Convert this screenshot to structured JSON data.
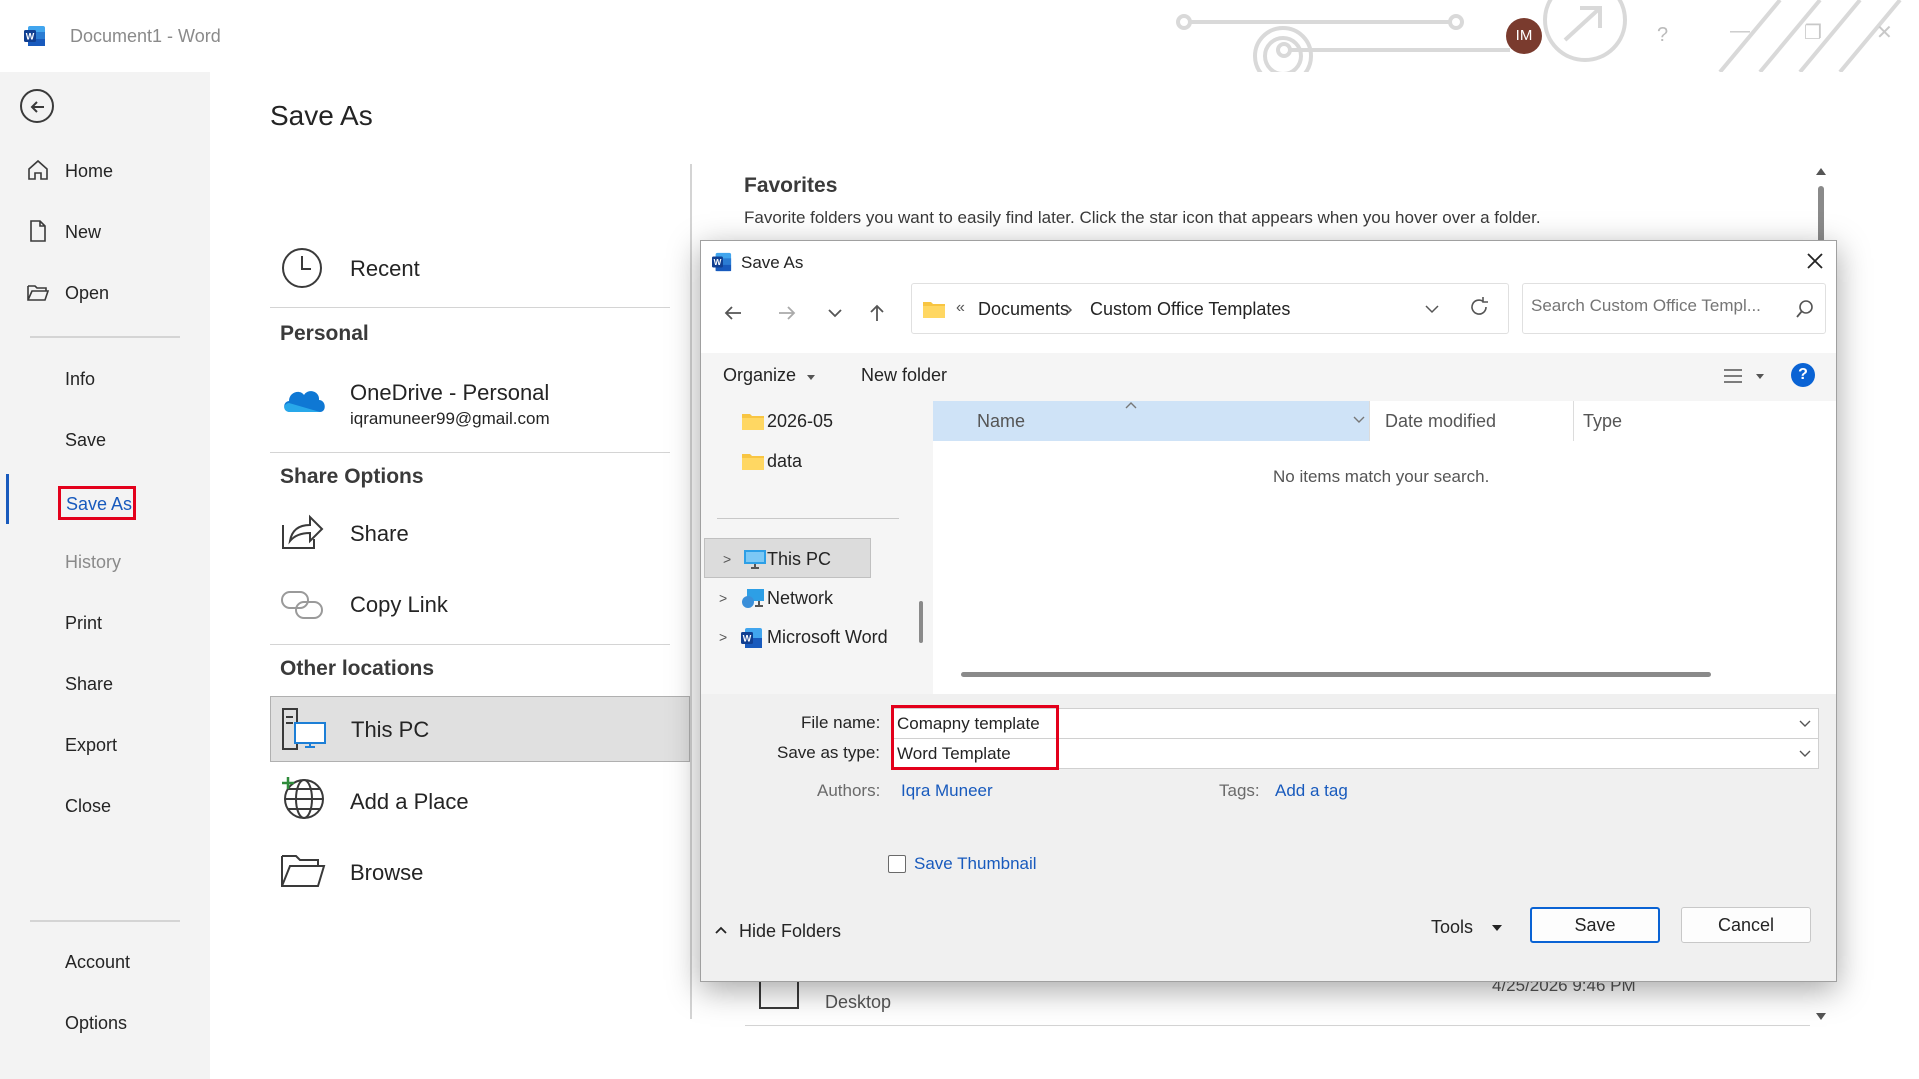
{
  "titlebar": {
    "doc_title": "Document1  -  Word",
    "avatar_initials": "IM",
    "help_label": "?"
  },
  "leftnav": {
    "home": "Home",
    "new": "New",
    "open": "Open",
    "info": "Info",
    "save": "Save",
    "save_as": "Save As",
    "history": "History",
    "print": "Print",
    "share": "Share",
    "export": "Export",
    "close": "Close",
    "account": "Account",
    "options": "Options"
  },
  "main": {
    "title": "Save As",
    "recent": "Recent",
    "personal_heading": "Personal",
    "onedrive_label": "OneDrive - Personal",
    "onedrive_email": "iqramuneer99@gmail.com",
    "share_heading": "Share Options",
    "share": "Share",
    "copy_link": "Copy Link",
    "other_heading": "Other locations",
    "this_pc": "This PC",
    "add_place": "Add a Place",
    "browse": "Browse",
    "favorites_title": "Favorites",
    "favorites_desc": "Favorite folders you want to easily find later. Click the star icon that appears when you hover over a folder.",
    "bg_row_name": "Desktop",
    "bg_row_date": "4/25/2026 9:46 PM"
  },
  "dialog": {
    "title": "Save As",
    "breadcrumb_prefix": "«",
    "crumb1": "Documents",
    "crumb2": "Custom Office Templates",
    "search_placeholder": "Search Custom Office Templ...",
    "organize": "Organize",
    "new_folder": "New folder",
    "folders": {
      "f1": "2026-05",
      "f2": "data",
      "this_pc": "This PC",
      "network": "Network",
      "msword": "Microsoft Word"
    },
    "columns": {
      "name": "Name",
      "date": "Date modified",
      "type": "Type"
    },
    "empty_message": "No items match your search.",
    "file_name_label": "File name:",
    "file_name_value": "Comapny template",
    "save_type_label": "Save as type:",
    "save_type_value": "Word Template",
    "authors_label": "Authors:",
    "authors_value": "Iqra Muneer",
    "tags_label": "Tags:",
    "tags_value": "Add a tag",
    "save_thumbnail": "Save Thumbnail",
    "hide_folders": "Hide Folders",
    "tools": "Tools",
    "save_button": "Save",
    "cancel_button": "Cancel"
  },
  "colors": {
    "accent": "#185abd",
    "highlight_red": "#e3001b",
    "primary_button": "#0a63d4"
  }
}
